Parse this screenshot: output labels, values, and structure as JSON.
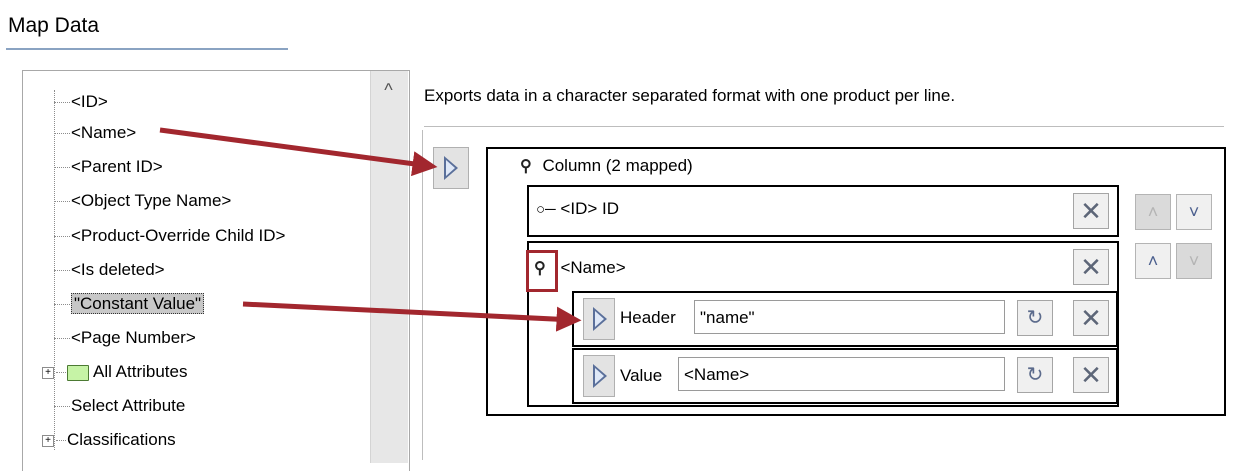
{
  "page": {
    "title": "Map Data"
  },
  "tree": {
    "items": [
      {
        "label": "<ID>"
      },
      {
        "label": "<Name>"
      },
      {
        "label": "<Parent ID>"
      },
      {
        "label": "<Object Type Name>"
      },
      {
        "label": "<Product-Override Child ID>"
      },
      {
        "label": "<Is deleted>"
      },
      {
        "label": "\"Constant Value\""
      },
      {
        "label": "<Page Number>"
      },
      {
        "label": "All Attributes"
      },
      {
        "label": "Select Attribute"
      },
      {
        "label": "Classifications"
      }
    ],
    "scroll_up_glyph": "^"
  },
  "main": {
    "description": "Exports data in a character separated format with one product per line.",
    "column": {
      "label": "Column (2 mapped)",
      "id_row": {
        "label": "<ID> ID"
      },
      "name_row": {
        "label": "<Name>",
        "header": {
          "label": "Header",
          "value": "\"name\""
        },
        "value": {
          "label": "Value",
          "value": "<Name>"
        }
      }
    }
  },
  "icons": {
    "pin": "pin-icon",
    "key": "key-icon",
    "close": "close-icon",
    "sync": "sync-icon",
    "play": "play-icon",
    "up": "chevron-up-icon",
    "down": "chevron-down-icon",
    "folder": "folder-icon",
    "expand": "expand-icon"
  },
  "colors": {
    "arrow": "#a2272e",
    "title_underline": "#8aa3c2",
    "folder": "#c6f3a6",
    "selection": "#c7c7c7"
  }
}
